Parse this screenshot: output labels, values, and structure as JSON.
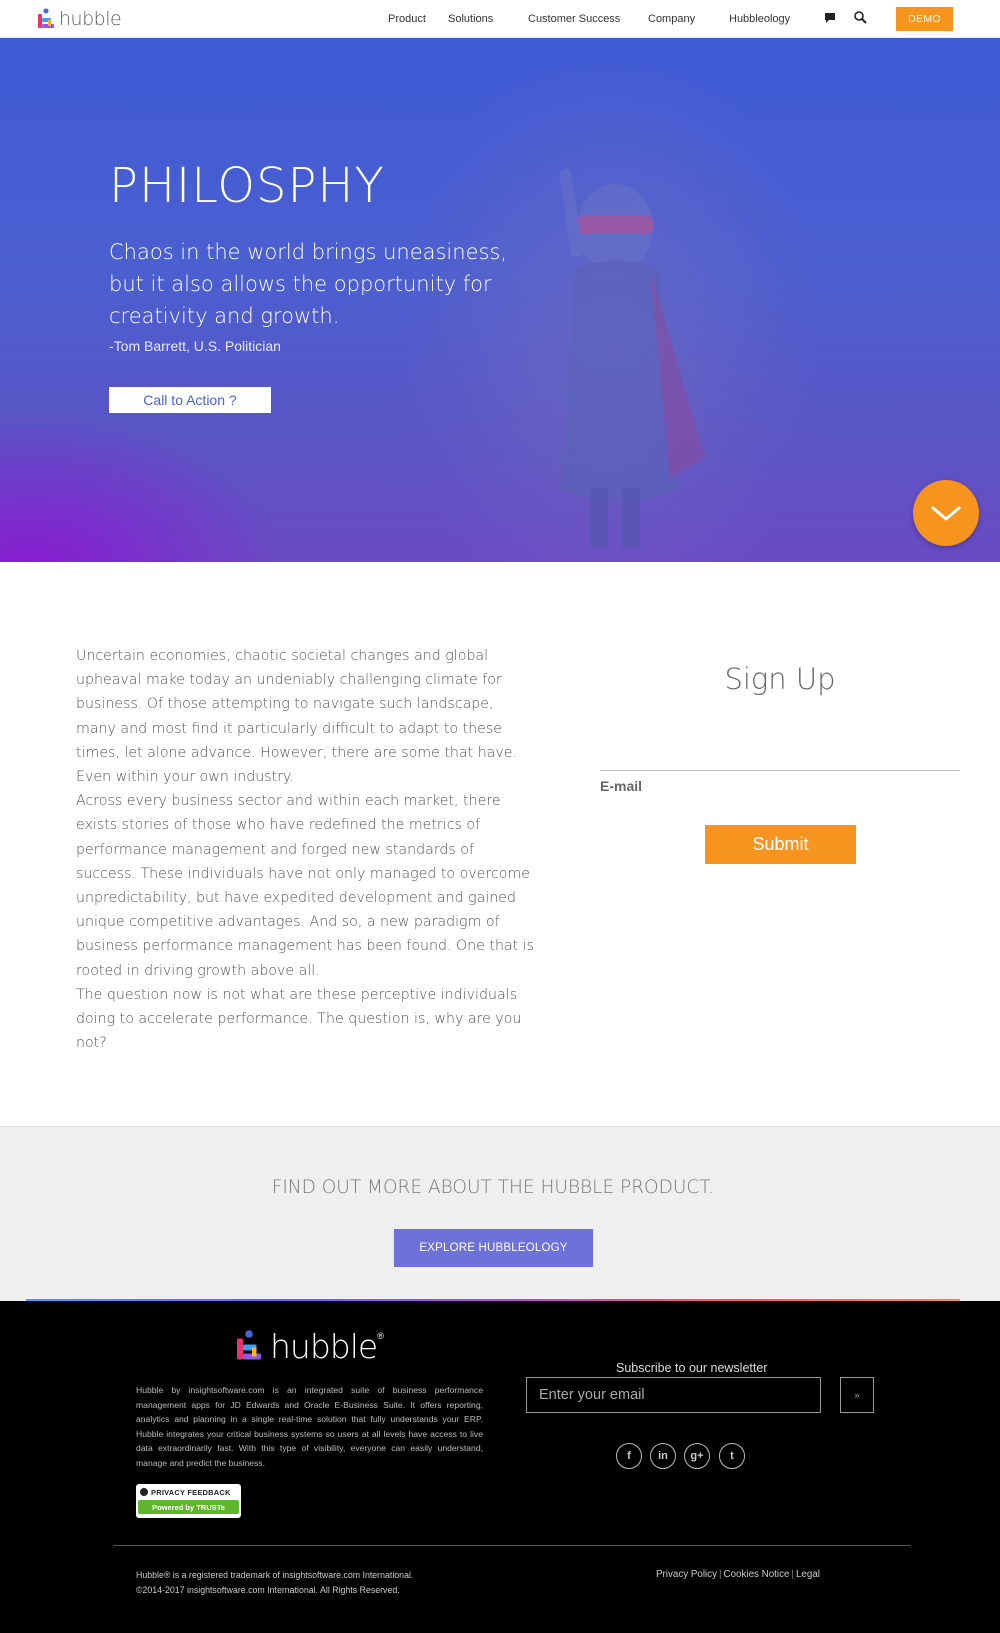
{
  "nav": {
    "logo_text": "hubble",
    "links": [
      "Product",
      "Solutions",
      "Customer Success",
      "Company",
      "Hubbleology"
    ],
    "demo_label": "DEMO"
  },
  "hero": {
    "title": "PHILOSPHY",
    "quote": "Chaos in the world brings uneasiness, but it also allows the opportunity for creativity and growth.",
    "author": "-Tom Barrett, U.S. Politician",
    "cta_label": "Call to Action ?"
  },
  "content": {
    "paragraphs": [
      "Uncertain economies, chaotic societal changes and global upheaval make today an undeniably challenging climate for business. Of those attempting to navigate such landscape, many and most find it particularly difficult to adapt to these times, let alone advance. However, there are some that have. Even within your own industry.",
      "Across every business sector and within each market, there exists stories of those who have redefined the metrics of performance management and forged new standards of success. These individuals have not only managed to overcome unpredictability, but have expedited development and gained unique competitive advantages. And so, a new paradigm of business performance management has been found. One that is rooted in driving growth above all.",
      "The question now is not what are these perceptive individuals doing to accelerate performance. The question is, why are you not?"
    ]
  },
  "signup": {
    "title": "Sign Up",
    "email_label": "E-mail",
    "submit_label": "Submit"
  },
  "band": {
    "title": "FIND OUT MORE ABOUT THE HUBBLE PRODUCT.",
    "button_label": "EXPLORE HUBBLEOLOGY"
  },
  "footer": {
    "logo_text": "hubble",
    "logo_mark": "®",
    "description": "Hubble by insightsoftware.com is an integrated suite of business performance management apps for JD Edwards and Oracle E-Business Suite. It offers reporting, analytics and planning in a single real-time solution that fully understands your ERP. Hubble integrates your critical business systems so users at all levels have access to live data extraordinarily fast. With this type of visibility, everyone can easily understand, manage and predict the business.",
    "trust_top": "PRIVACY FEEDBACK",
    "trust_bottom": "Powered by TRUSTe",
    "newsletter_title": "Subscribe to our newsletter",
    "email_placeholder": "Enter your email",
    "subscribe_button": "»",
    "social": [
      "f",
      "in",
      "g+",
      "t"
    ],
    "copyright_1": "Hubble® is a registered trademark of insightsoftware.com International.",
    "copyright_2": "©2014-2017 insightsoftware.com International. All Rights Reserved.",
    "links": [
      "Privacy Policy",
      "Cookies Notice",
      "Legal"
    ]
  },
  "colors": {
    "accent_orange": "#f7941d",
    "hero_blue": "#4b5fd0",
    "explore_purple": "#6f71db"
  }
}
